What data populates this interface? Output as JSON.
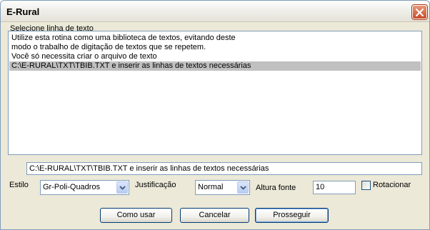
{
  "window": {
    "title": "E-Rural"
  },
  "list": {
    "label": "Selecione linha de texto",
    "items": [
      "Utilize esta rotina como uma biblioteca de textos, evitando deste",
      "modo o trabalho de digitação de textos que se repetem.",
      "Você só necessita criar o arquivo de texto",
      "C:\\E-RURAL\\TXT\\TBIB.TXT e inserir as linhas de textos necessárias"
    ],
    "selected_index": 3
  },
  "text_field": {
    "value": "C:\\E-RURAL\\TXT\\TBIB.TXT e inserir as linhas de textos necessárias"
  },
  "options": {
    "estilo_label": "Estilo",
    "estilo_value": "Gr-Poli-Quadros",
    "justificacao_label": "Justificação",
    "justificacao_value": "Normal",
    "altura_label": "Altura fonte",
    "altura_value": "10",
    "rotacionar_label": "Rotacionar",
    "rotacionar_checked": false
  },
  "buttons": {
    "como_usar": "Como usar",
    "cancelar": "Cancelar",
    "prosseguir": "Prosseguir"
  },
  "colors": {
    "selection": "#c0c0c0",
    "close_button": "#c74a25",
    "dialog_bg": "#ece9d8"
  }
}
